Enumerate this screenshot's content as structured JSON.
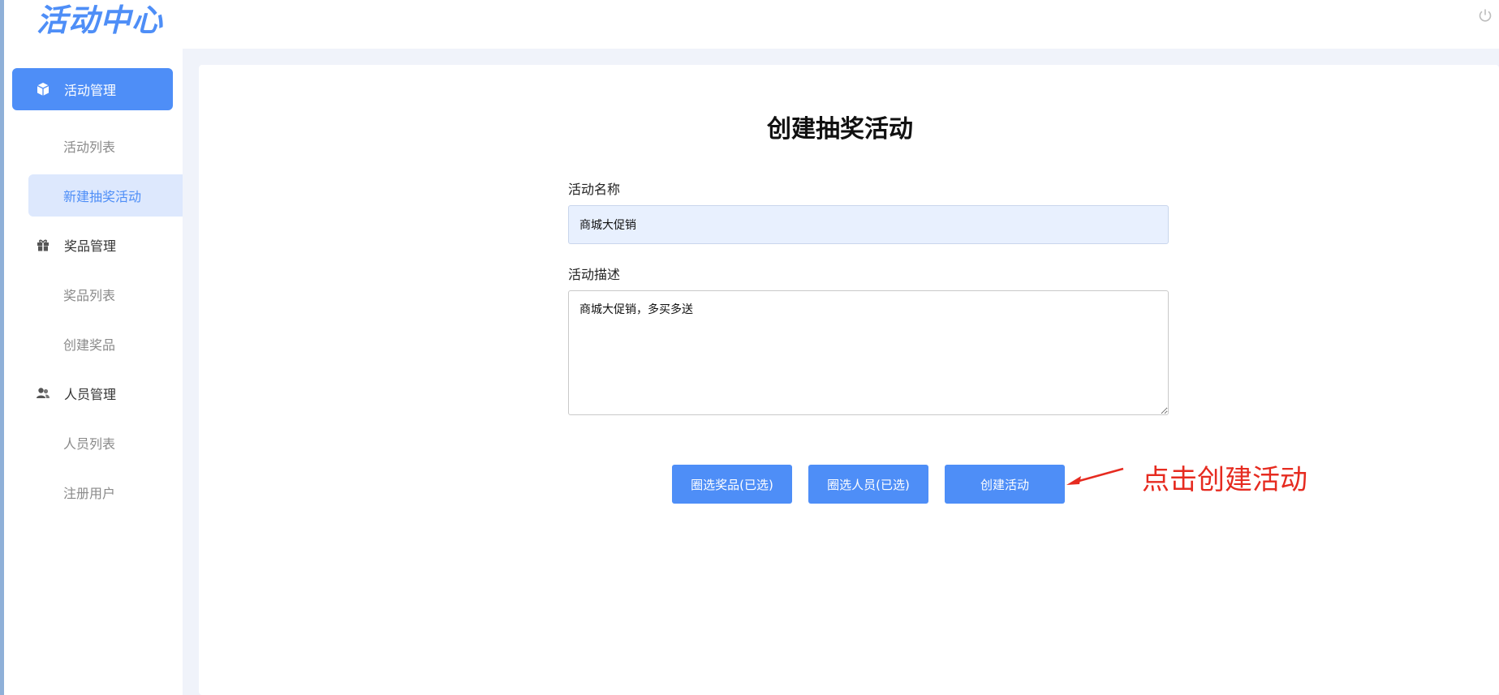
{
  "header": {
    "logo": "活动中心"
  },
  "sidebar": {
    "groups": [
      {
        "label": "活动管理",
        "active": true,
        "items": [
          {
            "label": "活动列表",
            "active": false
          },
          {
            "label": "新建抽奖活动",
            "active": true
          }
        ]
      },
      {
        "label": "奖品管理",
        "active": false,
        "items": [
          {
            "label": "奖品列表",
            "active": false
          },
          {
            "label": "创建奖品",
            "active": false
          }
        ]
      },
      {
        "label": "人员管理",
        "active": false,
        "items": [
          {
            "label": "人员列表",
            "active": false
          },
          {
            "label": "注册用户",
            "active": false
          }
        ]
      }
    ]
  },
  "form": {
    "title": "创建抽奖活动",
    "name_label": "活动名称",
    "name_value": "商城大促销",
    "desc_label": "活动描述",
    "desc_value": "商城大促销，多买多送",
    "buttons": {
      "select_prizes": "圈选奖品(已选)",
      "select_people": "圈选人员(已选)",
      "create": "创建活动"
    }
  },
  "annotation": {
    "text": "点击创建活动",
    "color": "#e62b20"
  },
  "colors": {
    "accent": "#4e8ef7",
    "active_sub_bg": "#dde8fd",
    "content_bg": "#f0f3fa"
  }
}
